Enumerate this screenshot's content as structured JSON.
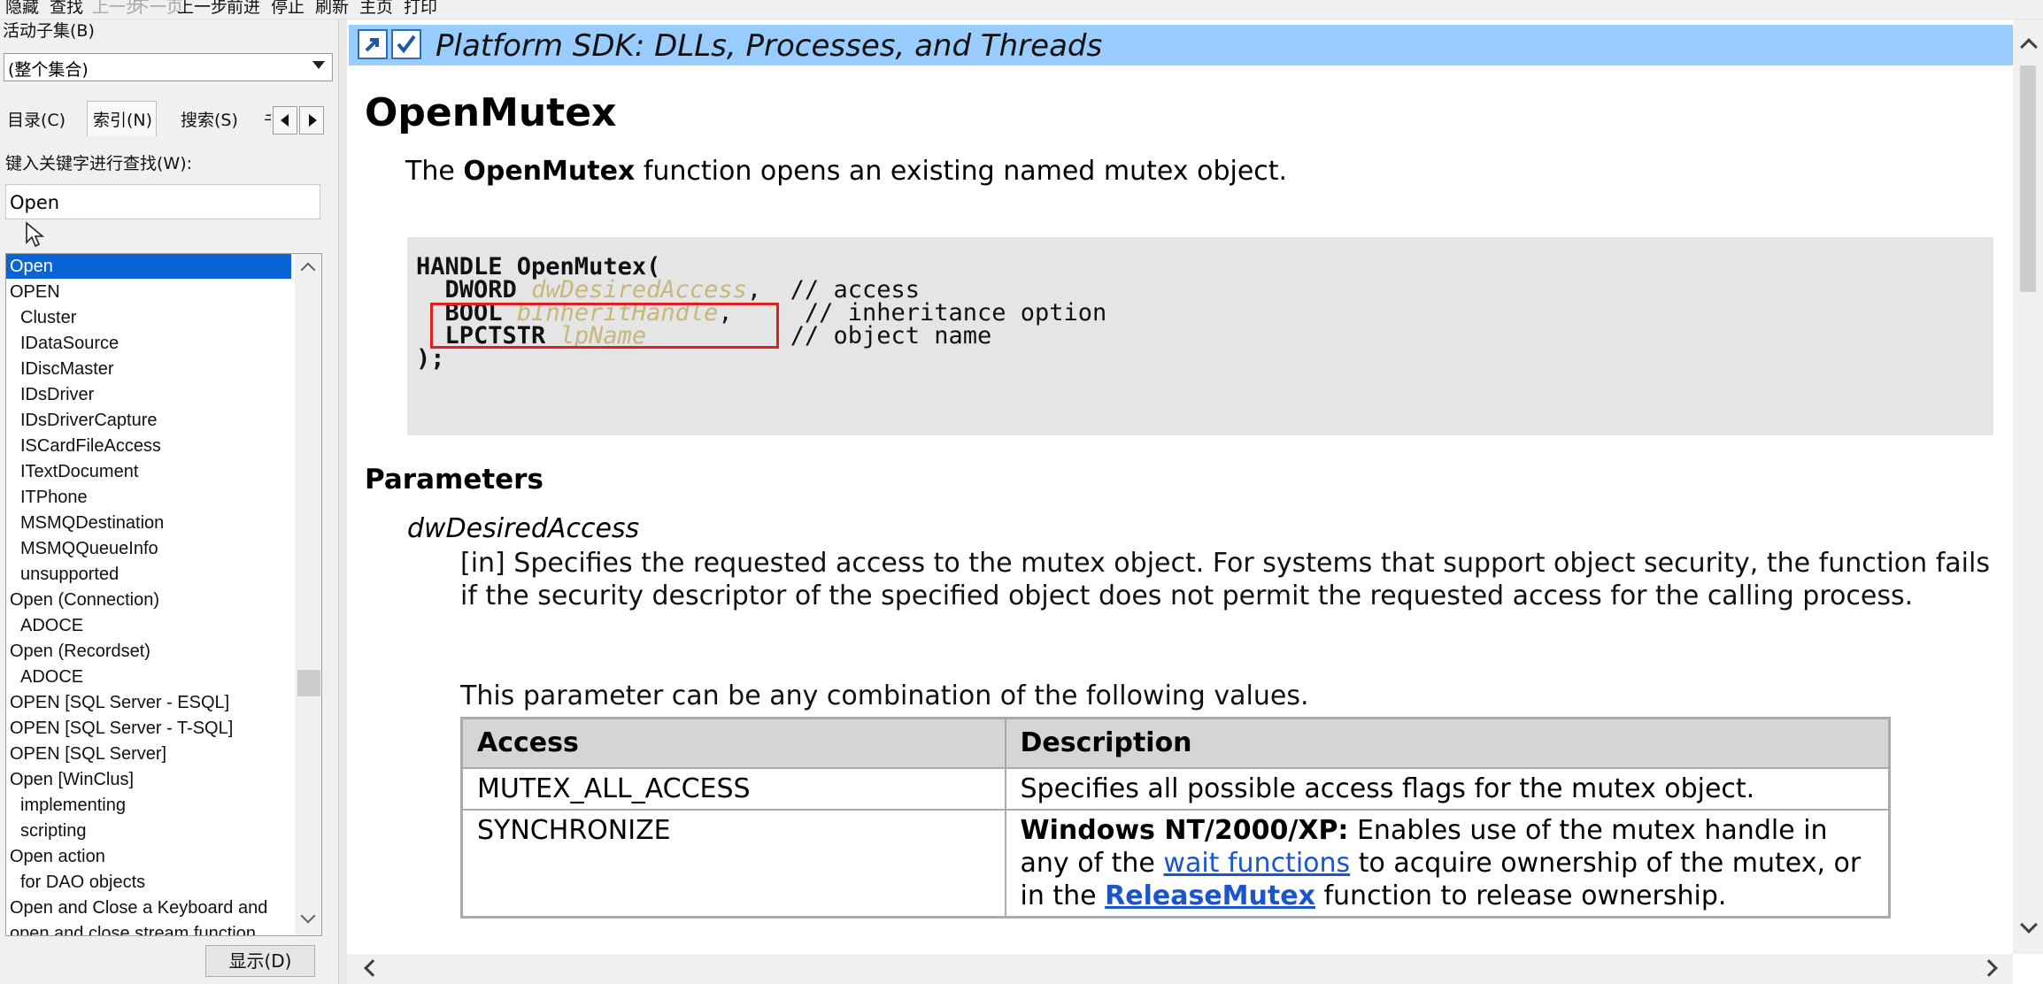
{
  "toolbar": {
    "items": [
      "隐藏",
      "查找",
      "上一步",
      "下一页",
      "上一步",
      "前进",
      "停止",
      "刷新",
      "主页",
      "打印"
    ]
  },
  "left": {
    "subset_label": "活动子集(B)",
    "subset_value": "(整个集合)",
    "tabs": [
      "目录(C)",
      "索引(N)",
      "搜索(S)",
      "书"
    ],
    "keyword_label": "键入关键字进行查找(W):",
    "keyword_value": "Open",
    "index_items": [
      "Open",
      "OPEN",
      "Cluster",
      "IDataSource",
      "IDiscMaster",
      "IDsDriver",
      "IDsDriverCapture",
      "ISCardFileAccess",
      "ITextDocument",
      "ITPhone",
      "MSMQDestination",
      "MSMQQueueInfo",
      "unsupported",
      "Open (Connection)",
      "ADOCE",
      "Open (Recordset)",
      "ADOCE",
      "OPEN [SQL Server - ESQL]",
      "OPEN [SQL Server - T-SQL]",
      "OPEN [SQL Server]",
      "Open [WinClus]",
      "implementing",
      "scripting",
      "Open action",
      "for DAO objects",
      "Open and Close a Keyboard and",
      "open and close stream function"
    ],
    "display_button": "显示(D)"
  },
  "content": {
    "banner_title": "Platform SDK: DLLs, Processes, and Threads",
    "page_title": "OpenMutex",
    "intro_prefix": "The ",
    "intro_name": "OpenMutex",
    "intro_suffix": " function opens an existing named mutex object.",
    "code": {
      "line1_kw": "HANDLE OpenMutex(",
      "line2_kw": "DWORD",
      "line2_param": "dwDesiredAccess",
      "line2_comment": ",  // access",
      "line3_kw": "BOOL",
      "line3_param": "bInheritHandle",
      "line3_comment": ",     // inheritance option",
      "line4_kw": "LPCTSTR",
      "line4_param": "lpName",
      "line4_comment": "// object name",
      "line5": ");"
    },
    "parameters_heading": "Parameters",
    "param1_name": "dwDesiredAccess",
    "param1_desc": "[in] Specifies the requested access to the mutex object. For systems that support object security, the function fails if the security descriptor of the specified object does not permit the requested access for the calling process.",
    "param1_values_note": "This parameter can be any combination of the following values.",
    "table": {
      "header_access": "Access",
      "header_description": "Description",
      "row1_access": "MUTEX_ALL_ACCESS",
      "row1_desc": "Specifies all possible access flags for the mutex object.",
      "row2_access": "SYNCHRONIZE",
      "row2_os": "Windows NT/2000/XP:",
      "row2_desc_a": " Enables use of the mutex handle in any of the ",
      "row2_link1": "wait functions",
      "row2_desc_b": " to acquire ownership of the mutex, or in the ",
      "row2_link2": "ReleaseMutex",
      "row2_desc_c": " function to release ownership."
    }
  }
}
